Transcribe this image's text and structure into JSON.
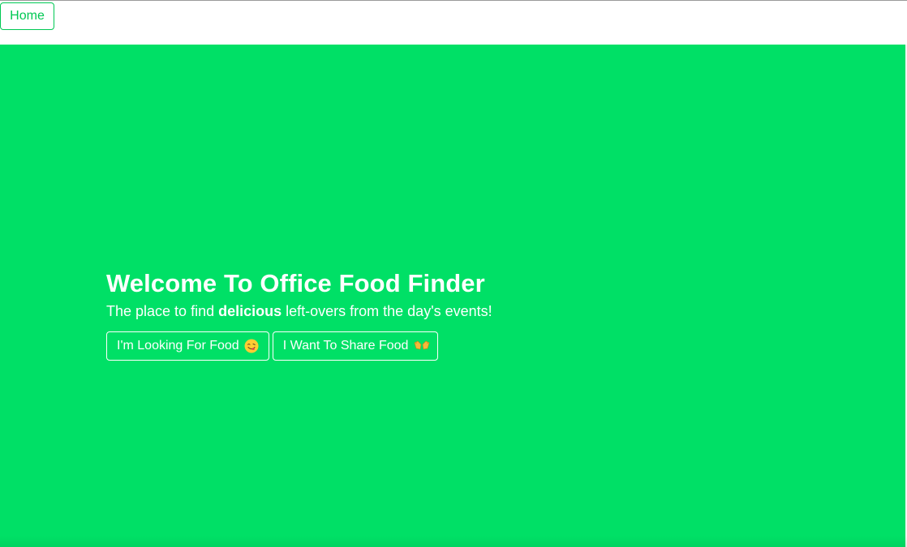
{
  "nav": {
    "home_label": "Home"
  },
  "hero": {
    "title": "Welcome To Office Food Finder",
    "subtitle_before": "The place to find ",
    "subtitle_bold": "delicious",
    "subtitle_after": " left-overs from the day's events!",
    "buttons": [
      {
        "label": "I'm Looking For Food",
        "icon": "yum-face-icon"
      },
      {
        "label": "I Want To Share Food",
        "icon": "open-hands-icon"
      }
    ]
  },
  "colors": {
    "accent": "#00c853",
    "hero_background": "#00e066",
    "text_on_hero": "#ffffff"
  }
}
